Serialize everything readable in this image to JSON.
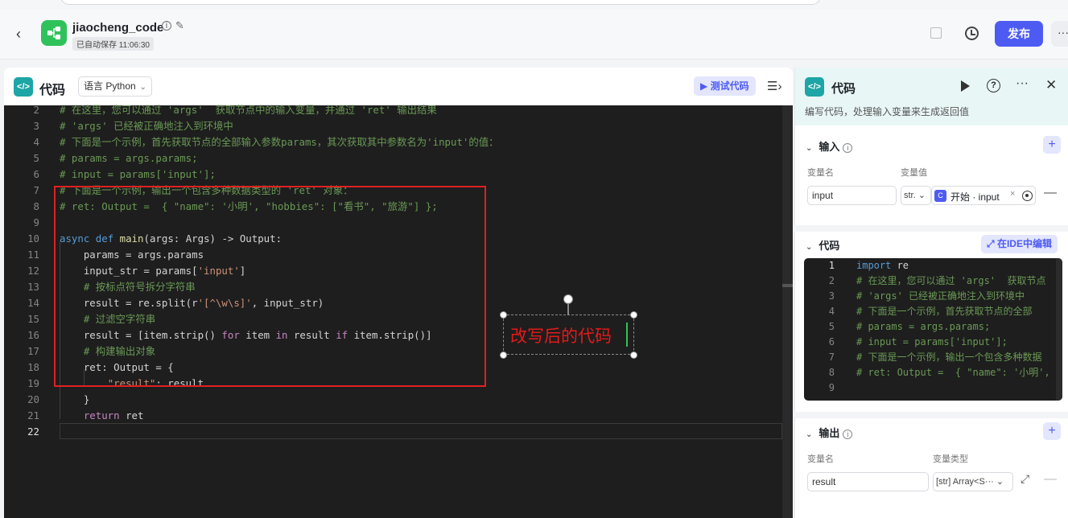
{
  "header": {
    "app_name": "jiaocheng_code",
    "autosave": "已自动保存 11:06:30",
    "publish_label": "发布",
    "more_label": "···"
  },
  "left_panel": {
    "title": "代码",
    "language_label": "语言 Python",
    "test_code_label": "测试代码",
    "icon_glyph": "</>"
  },
  "editor": {
    "lines": [
      {
        "n": "2",
        "code": "# 在这里，您可以通过 'args'  获取节点中的输入变量，并通过 'ret' 输出结果"
      },
      {
        "n": "3",
        "code": "# 'args' 已经被正确地注入到环境中"
      },
      {
        "n": "4",
        "code": "# 下面是一个示例，首先获取节点的全部输入参数params，其次获取其中参数名为'input'的值："
      },
      {
        "n": "5",
        "code": "# params = args.params;"
      },
      {
        "n": "6",
        "code": "# input = params['input'];"
      },
      {
        "n": "7",
        "code": "# 下面是一个示例，输出一个包含多种数据类型的 'ret' 对象："
      },
      {
        "n": "8",
        "code": "# ret: Output =  { \"name\": '小明', \"hobbies\": [\"看书\", \"旅游\"] };"
      },
      {
        "n": "9",
        "code": ""
      },
      {
        "n": "10",
        "code": "async def main(args: Args) -> Output:"
      },
      {
        "n": "11",
        "code": "    params = args.params"
      },
      {
        "n": "12",
        "code": "    input_str = params['input']"
      },
      {
        "n": "13",
        "code": "    # 按标点符号拆分字符串"
      },
      {
        "n": "14",
        "code": "    result = re.split(r'[^\\w\\s]', input_str)"
      },
      {
        "n": "15",
        "code": "    # 过滤空字符串"
      },
      {
        "n": "16",
        "code": "    result = [item.strip() for item in result if item.strip()]"
      },
      {
        "n": "17",
        "code": "    # 构建输出对象"
      },
      {
        "n": "18",
        "code": "    ret: Output = {"
      },
      {
        "n": "19",
        "code": "        \"result\": result"
      },
      {
        "n": "20",
        "code": "    }"
      },
      {
        "n": "21",
        "code": "    return ret"
      },
      {
        "n": "22",
        "code": ""
      }
    ]
  },
  "annotation": {
    "text": "改写后的代码"
  },
  "right_panel": {
    "title": "代码",
    "description": "编写代码，处理输入变量来生成返回值",
    "input_section": {
      "title": "输入",
      "col_name": "变量名",
      "col_value": "变量值",
      "var_name": "input",
      "type_short": "str.",
      "ref_text": "开始 · input"
    },
    "code_section": {
      "title": "代码",
      "ide_label": "在IDE中编辑",
      "lines": [
        {
          "n": "1",
          "code": "import re"
        },
        {
          "n": "2",
          "code": "# 在这里，您可以通过 'args'  获取节点"
        },
        {
          "n": "3",
          "code": "# 'args' 已经被正确地注入到环境中"
        },
        {
          "n": "4",
          "code": "# 下面是一个示例，首先获取节点的全部"
        },
        {
          "n": "5",
          "code": "# params = args.params;"
        },
        {
          "n": "6",
          "code": "# input = params['input'];"
        },
        {
          "n": "7",
          "code": "# 下面是一个示例，输出一个包含多种数据"
        },
        {
          "n": "8",
          "code": "# ret: Output =  { \"name\": '小明',"
        },
        {
          "n": "9",
          "code": ""
        }
      ]
    },
    "output_section": {
      "title": "输出",
      "col_name": "变量名",
      "col_type": "变量类型",
      "var_name": "result",
      "type_label": "[str] Array<S···"
    }
  }
}
